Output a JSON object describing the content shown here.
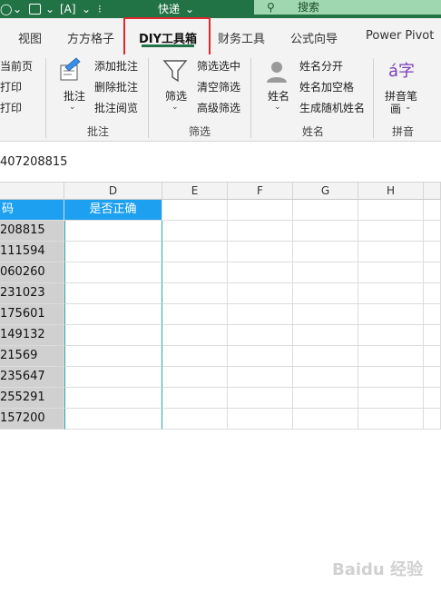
{
  "titlebar": {
    "quick_label": "快递",
    "search_label": "搜索"
  },
  "tabs": [
    "视图",
    "方方格子",
    "DIY工具箱",
    "财务工具",
    "公式向导",
    "Power Pivot"
  ],
  "ribbon": {
    "left_partial": [
      "当前页",
      "打印",
      "打印"
    ],
    "annotate_group": {
      "big_button": "批注",
      "items": [
        "添加批注",
        "删除批注",
        "批注阅览"
      ],
      "group_label": "批注"
    },
    "filter_group": {
      "big_button": "筛选",
      "items": [
        "筛选选中",
        "清空筛选",
        "高级筛选"
      ],
      "group_label": "筛选"
    },
    "name_group": {
      "big_button": "姓名",
      "items": [
        "姓名分开",
        "姓名加空格",
        "生成随机姓名"
      ],
      "group_label": "姓名"
    },
    "pinyin_group": {
      "button_line1": "拼音笔",
      "button_line2": "画",
      "icon_text": "á字",
      "group_label": "拼音"
    }
  },
  "formula_bar": {
    "value": "407208815"
  },
  "columns": [
    "D",
    "E",
    "F",
    "G",
    "H"
  ],
  "c_header": "码",
  "d_header": "是否正确",
  "rows": [
    "208815",
    "111594",
    "060260",
    "231023",
    "175601",
    "149132",
    "21569",
    "235647",
    "255291",
    "157200"
  ],
  "watermark": "Baidu 经验",
  "colors": {
    "excel_green": "#217346",
    "highlight_red": "#e2282b",
    "header_blue": "#1ea0f0"
  }
}
